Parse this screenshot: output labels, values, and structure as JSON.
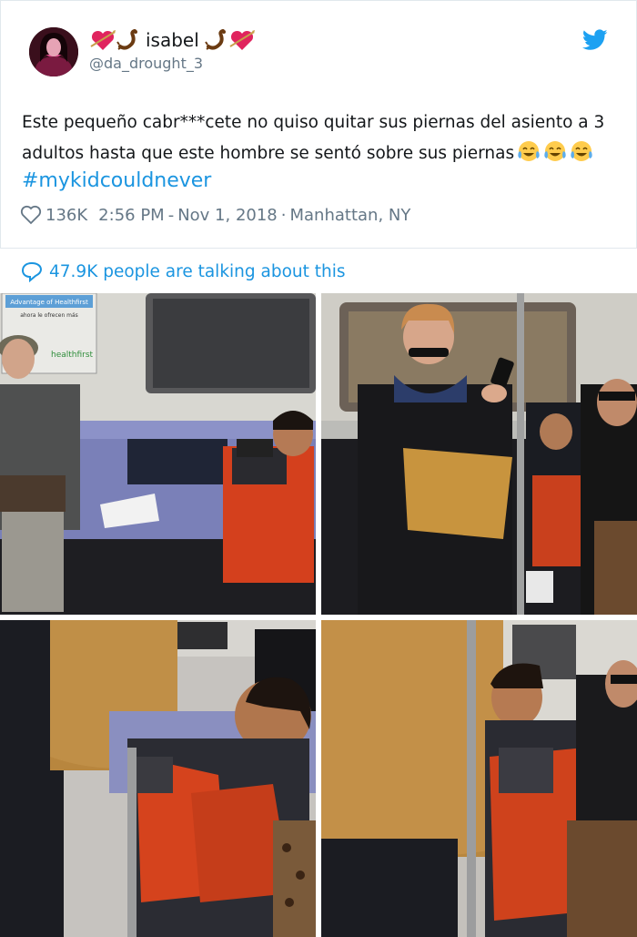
{
  "tweet": {
    "display_name": "isabel",
    "handle": "@da_drought_3",
    "text_line_1": "Este pequeño cabr***cete no quiso quitar sus piernas del asiento a 3",
    "text_line_2": "adultos hasta que este hombre se sentó sobre sus piernas",
    "hashtag": "#mykidcouldnever",
    "likes": "136K",
    "time": "2:56 PM",
    "date": "Nov 1, 2018",
    "location": "Manhattan, NY",
    "talking": "47.9K people are talking about this",
    "name_emojis": [
      "heart-with-arrow-icon",
      "scorpion-icon"
    ],
    "bird_icon": "twitter-bird-icon",
    "accent": "#1b95e0"
  },
  "photos": {
    "photo1": {
      "poster_title": "Advantage of Healthfirst",
      "poster_sub": "ahora le ofrecen más",
      "poster_brand": "healthfirst"
    },
    "photo2": {},
    "photo3": {},
    "photo4": {}
  }
}
